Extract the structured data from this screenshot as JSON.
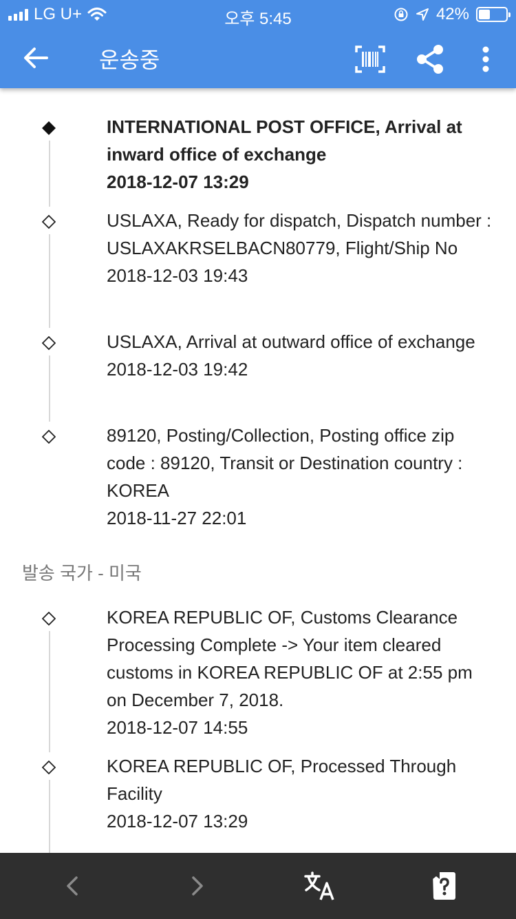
{
  "status_bar": {
    "carrier": "LG U+",
    "time": "오후 5:45",
    "battery": "42%",
    "battery_level": 0.42
  },
  "toolbar": {
    "title": "운송중",
    "icons": [
      "back-arrow-icon",
      "barcode-scan-icon",
      "share-icon",
      "more-vert-icon"
    ]
  },
  "colors": {
    "header": "#4a8ee6",
    "bottom_bar": "#2f2f2f"
  },
  "sections": [
    {
      "events": [
        {
          "description": "INTERNATIONAL POST OFFICE, Arrival at inward office of exchange",
          "datetime": "2018-12-07 13:29",
          "latest": true
        },
        {
          "description": "USLAXA, Ready for dispatch, Dispatch number : USLAXAKRSELBACN80779, Flight/Ship No",
          "datetime": "2018-12-03 19:43"
        },
        {
          "description": "USLAXA, Arrival at outward office of exchange",
          "datetime": "2018-12-03 19:42"
        },
        {
          "description": "89120, Posting/Collection, Posting office zip code : 89120, Transit or Destination country : KOREA",
          "datetime": "2018-11-27 22:01"
        }
      ]
    },
    {
      "label": "발송 국가 - 미국",
      "events": [
        {
          "description": "KOREA REPUBLIC OF, Customs Clearance Processing Complete -> Your item cleared customs in KOREA REPUBLIC OF at 2:55 pm on December 7, 2018.",
          "datetime": "2018-12-07 14:55"
        },
        {
          "description": "KOREA REPUBLIC OF, Processed Through Facility",
          "datetime": "2018-12-07 13:29"
        }
      ]
    }
  ],
  "bottom_bar": {
    "icons": [
      "chevron-left-icon",
      "chevron-right-icon",
      "translate-icon",
      "help-icon"
    ]
  }
}
